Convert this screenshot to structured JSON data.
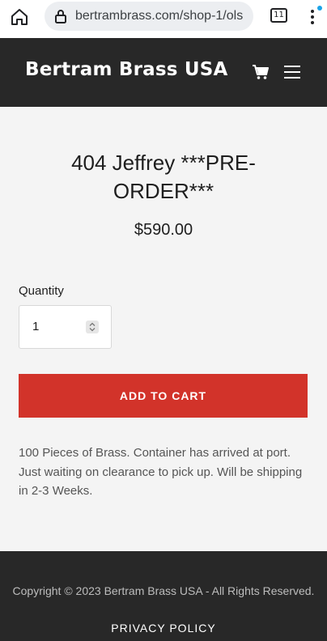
{
  "browser": {
    "url": "bertrambrass.com/shop-1/ols",
    "tab_count": "11"
  },
  "header": {
    "brand": "Bertram Brass USA",
    "icons": [
      "cart-icon",
      "hamburger-menu-icon"
    ]
  },
  "product": {
    "title": "404 Jeffrey ***PRE-ORDER***",
    "price": "$590.00",
    "quantity_label": "Quantity",
    "quantity_value": "1",
    "add_to_cart": "ADD TO CART",
    "description": "100 Pieces of Brass. Container has arrived at port. Just waiting on clearance to pick up. Will be shipping in 2-3 Weeks."
  },
  "footer": {
    "copyright": "Copyright © 2023 Bertram Brass USA - All Rights Reserved.",
    "privacy": "PRIVACY POLICY"
  },
  "colors": {
    "header_bg": "#282828",
    "accent_button": "#d2332a",
    "page_bg": "#f4f4f4"
  }
}
